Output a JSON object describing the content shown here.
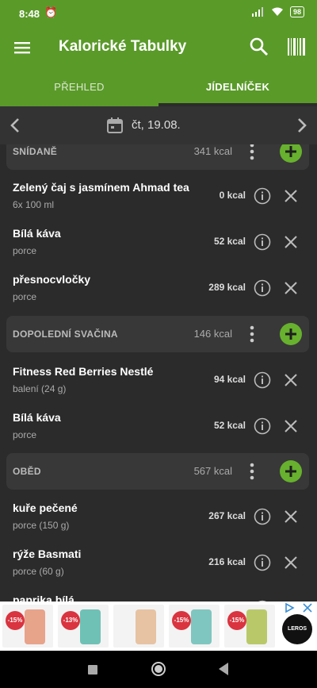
{
  "status": {
    "time": "8:48",
    "battery": "98"
  },
  "app": {
    "title": "Kalorické Tabulky"
  },
  "tabs": [
    {
      "label": "PŘEHLED"
    },
    {
      "label": "JÍDELNÍČEK"
    }
  ],
  "date": {
    "label": "čt, 19.08."
  },
  "meals": [
    {
      "name": "SNÍDANĚ",
      "kcal": "341 kcal",
      "items": [
        {
          "name": "Zelený čaj s jasmínem Ahmad tea",
          "portion": "6x 100 ml",
          "kcal": "0 kcal"
        },
        {
          "name": "Bílá káva",
          "portion": "porce",
          "kcal": "52 kcal"
        },
        {
          "name": "přesnocvločky",
          "portion": "porce",
          "kcal": "289 kcal"
        }
      ]
    },
    {
      "name": "DOPOLEDNÍ SVAČINA",
      "kcal": "146 kcal",
      "items": [
        {
          "name": "Fitness Red Berries Nestlé",
          "portion": "balení (24 g)",
          "kcal": "94 kcal"
        },
        {
          "name": "Bílá káva",
          "portion": "porce",
          "kcal": "52 kcal"
        }
      ]
    },
    {
      "name": "OBĚD",
      "kcal": "567 kcal",
      "items": [
        {
          "name": "kuře pečené",
          "portion": "porce (150 g)",
          "kcal": "267 kcal"
        },
        {
          "name": "rýže Basmati",
          "portion": "porce (60 g)",
          "kcal": "216 kcal"
        },
        {
          "name": "paprika bílá",
          "portion": "",
          "kcal": ""
        }
      ]
    }
  ],
  "ad": {
    "tiles": [
      {
        "badge": "-15%",
        "color": "#e8a38b"
      },
      {
        "badge": "-13%",
        "color": "#6fc1b6"
      },
      {
        "badge": "",
        "color": "#e7c3a3"
      },
      {
        "badge": "-15%",
        "color": "#7fc6c0"
      },
      {
        "badge": "-15%",
        "color": "#b9c96a"
      }
    ],
    "logo": "LEROS"
  }
}
